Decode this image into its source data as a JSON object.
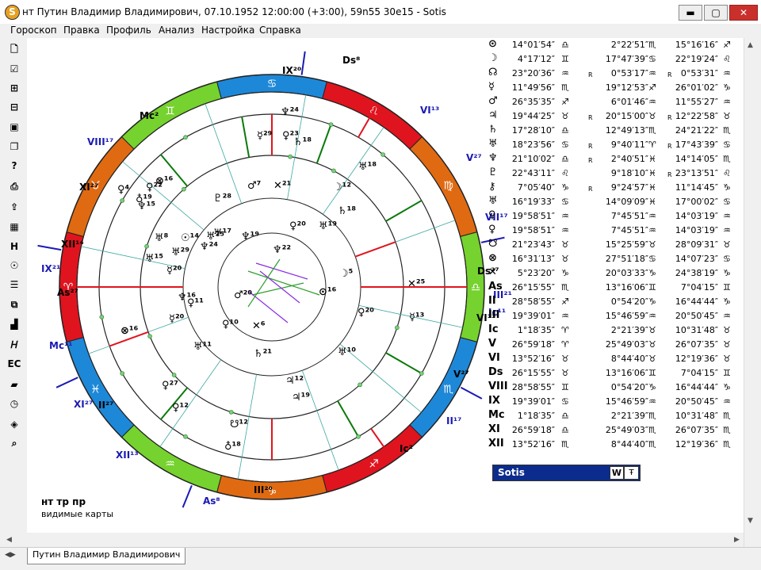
{
  "window": {
    "icon": "S",
    "title": "нт Путин Владимир Владимирович, 07.10.1952 12:00:00 (+3:00), 59n55 30e15 - Sotis",
    "minimize": "▬",
    "maximize": "▢",
    "close": "✕"
  },
  "menu": [
    "Гороскоп",
    "Правка",
    "Профиль",
    "Анализ",
    "Настройка",
    "Справка"
  ],
  "toolbar": [
    {
      "name": "new-doc-icon",
      "glyph": "🗋"
    },
    {
      "name": "check-doc-icon",
      "glyph": "☑"
    },
    {
      "name": "add-doc-icon",
      "glyph": "⊞"
    },
    {
      "name": "remove-doc-icon",
      "glyph": "⊟"
    },
    {
      "name": "picture-icon",
      "glyph": "▣"
    },
    {
      "name": "copy-icon",
      "glyph": "❐"
    },
    {
      "name": "help-doc-icon",
      "glyph": "?"
    },
    {
      "name": "print-icon",
      "glyph": "⎙"
    },
    {
      "name": "export-icon",
      "glyph": "⇪"
    },
    {
      "name": "grid-icon",
      "glyph": "▦"
    },
    {
      "name": "letter-h-icon",
      "glyph": "H"
    },
    {
      "name": "people-icon",
      "glyph": "☉"
    },
    {
      "name": "list-icon",
      "glyph": "☰"
    },
    {
      "name": "windows-icon",
      "glyph": "⧉"
    },
    {
      "name": "bar-chart-icon",
      "glyph": "▟"
    },
    {
      "name": "italic-h-icon",
      "glyph": "𝐻"
    },
    {
      "name": "ec-icon",
      "glyph": "EC"
    },
    {
      "name": "folder-icon",
      "glyph": "▰"
    },
    {
      "name": "clock-icon",
      "glyph": "◷"
    },
    {
      "name": "diamond-icon",
      "glyph": "◈"
    },
    {
      "name": "zoom-icon",
      "glyph": "⌕"
    }
  ],
  "colors": {
    "fire": "#e0141e",
    "earth": "#e06a12",
    "air": "#76d22e",
    "water": "#1e88d8",
    "axis_red": "#e0141e",
    "axis_blue": "#1a1ab4",
    "house_line": "#0a7a0a",
    "aspect_green": "#2e9e2e",
    "sotis_bar": "#0b2c8c"
  },
  "chart": {
    "signs": [
      "♈",
      "♉",
      "♊",
      "♋",
      "♌",
      "♍",
      "♎",
      "♏",
      "♐",
      "♑",
      "♒",
      "♓"
    ],
    "outer_labels": [
      {
        "t": "Ds⁸",
        "col": "#000"
      },
      {
        "t": "VI¹³",
        "col": "#1a1ab4"
      },
      {
        "t": "V²⁷",
        "col": "#1a1ab4"
      },
      {
        "t": "VII¹⁷",
        "col": "#1a1ab4"
      },
      {
        "t": "IX²⁰",
        "col": "#000"
      },
      {
        "t": "Mc²",
        "col": "#000"
      },
      {
        "t": "VIII¹⁷",
        "col": "#1a1ab4"
      },
      {
        "t": "XI²⁷",
        "col": "#000"
      },
      {
        "t": "XII¹⁴",
        "col": "#000"
      },
      {
        "t": "IX²¹",
        "col": "#1a1ab4"
      },
      {
        "t": "As²⁷",
        "col": "#000"
      },
      {
        "t": "Mc¹¹",
        "col": "#1a1ab4"
      },
      {
        "t": "XI²⁷",
        "col": "#1a1ab4"
      },
      {
        "t": "II²⁷",
        "col": "#000"
      },
      {
        "t": "XII¹³",
        "col": "#1a1ab4"
      },
      {
        "t": "As⁸",
        "col": "#1a1ab4"
      },
      {
        "t": "III²⁰",
        "col": "#000"
      },
      {
        "t": "Ic²",
        "col": "#000"
      },
      {
        "t": "II¹⁷",
        "col": "#1a1ab4"
      },
      {
        "t": "V²⁷",
        "col": "#000"
      },
      {
        "t": "VI¹³",
        "col": "#000"
      },
      {
        "t": "III²¹",
        "col": "#1a1ab4"
      },
      {
        "t": "Ds²⁷",
        "col": "#000"
      },
      {
        "t": "Ic¹¹",
        "col": "#1a1ab4"
      }
    ],
    "planet_labels": [
      "♆²⁴",
      "☿²⁹",
      "♀²³",
      "♄¹⁸",
      "♂⁷",
      "✕²¹",
      "☽¹²",
      "♇²⁸",
      "♅¹⁸",
      "♀²²",
      "♀⁴",
      "♁¹⁹",
      "♆¹⁵",
      "⊗¹⁶",
      "♅²⁵",
      "♅¹⁵",
      "♆²⁴",
      "☿²⁰",
      "♅²⁹",
      "♅⁸",
      "☉¹⁴",
      "♅¹⁷",
      "♆¹⁹",
      "♀¹¹",
      "⊗¹⁶",
      "☿²⁰",
      "♅¹¹",
      "✕²⁵",
      "☿¹³",
      "♀²⁰",
      "☽⁵",
      "⊙¹⁶",
      "♀²⁰",
      "♅¹⁹",
      "✕⁶",
      "♄¹⁸",
      "♀¹⁰",
      "♂²⁰",
      "♆¹⁶",
      "♄²¹",
      "♅¹⁰",
      "♃¹²",
      "♀²⁷",
      "♀¹²",
      "☋¹²",
      "♁¹⁸",
      "♃¹⁹",
      "♆²²"
    ],
    "legend_line1": "нт тр пр",
    "legend_line2": "видимые карты"
  },
  "table": [
    {
      "g": "⊙",
      "v1": "14°01′54″",
      "s1": "♎",
      "r2": "",
      "v2": "2°22′51″",
      "s2": "♏",
      "r3": "",
      "v3": "15°16′16″",
      "s3": "♐"
    },
    {
      "g": "☽",
      "v1": "4°17′12″",
      "s1": "♊",
      "r2": "",
      "v2": "17°47′39″",
      "s2": "♋",
      "r3": "",
      "v3": "22°19′24″",
      "s3": "♌"
    },
    {
      "g": "☊",
      "v1": "23°20′36″",
      "s1": "♒",
      "r2": "R",
      "v2": "0°53′17″",
      "s2": "♒",
      "r3": "R",
      "v3": "0°53′31″",
      "s3": "♒"
    },
    {
      "g": "☿",
      "v1": "11°49′56″",
      "s1": "♏",
      "r2": "",
      "v2": "19°12′53″",
      "s2": "♐",
      "r3": "",
      "v3": "26°01′02″",
      "s3": "♑"
    },
    {
      "g": "♂",
      "v1": "26°35′35″",
      "s1": "♐",
      "r2": "",
      "v2": "6°01′46″",
      "s2": "♒",
      "r3": "",
      "v3": "11°55′27″",
      "s3": "♒"
    },
    {
      "g": "♃",
      "v1": "19°44′25″",
      "s1": "♉",
      "r2": "R",
      "v2": "20°15′00″",
      "s2": "♉",
      "r3": "R",
      "v3": "12°22′58″",
      "s3": "♉"
    },
    {
      "g": "♄",
      "v1": "17°28′10″",
      "s1": "♎",
      "r2": "",
      "v2": "12°49′13″",
      "s2": "♏",
      "r3": "",
      "v3": "24°21′22″",
      "s3": "♏"
    },
    {
      "g": "♅",
      "v1": "18°23′56″",
      "s1": "♋",
      "r2": "R",
      "v2": "9°40′11″",
      "s2": "♈",
      "r3": "R",
      "v3": "17°43′39″",
      "s3": "♋"
    },
    {
      "g": "♆",
      "v1": "21°10′02″",
      "s1": "♎",
      "r2": "R",
      "v2": "2°40′51″",
      "s2": "♓",
      "r3": "",
      "v3": "14°14′05″",
      "s3": "♏"
    },
    {
      "g": "♇",
      "v1": "22°43′11″",
      "s1": "♌",
      "r2": "",
      "v2": "9°18′10″",
      "s2": "♓",
      "r3": "R",
      "v3": "23°13′51″",
      "s3": "♌"
    },
    {
      "g": "⚷",
      "v1": "7°05′40″",
      "s1": "♑",
      "r2": "R",
      "v2": "9°24′57″",
      "s2": "♓",
      "r3": "",
      "v3": "11°14′45″",
      "s3": "♑"
    },
    {
      "g": "♅",
      "v1": "16°19′33″",
      "s1": "♋",
      "r2": "",
      "v2": "14°09′09″",
      "s2": "♓",
      "r3": "",
      "v3": "17°00′02″",
      "s3": "♋"
    },
    {
      "g": "♀",
      "v1": "19°58′51″",
      "s1": "♒",
      "r2": "",
      "v2": "7°45′51″",
      "s2": "♒",
      "r3": "",
      "v3": "14°03′19″",
      "s3": "♒"
    },
    {
      "g": "♀",
      "v1": "19°58′51″",
      "s1": "♒",
      "r2": "",
      "v2": "7°45′51″",
      "s2": "♒",
      "r3": "",
      "v3": "14°03′19″",
      "s3": "♒"
    },
    {
      "g": "☋",
      "v1": "21°23′43″",
      "s1": "♉",
      "r2": "",
      "v2": "15°25′59″",
      "s2": "♉",
      "r3": "",
      "v3": "28°09′31″",
      "s3": "♉"
    },
    {
      "g": "⊗",
      "v1": "16°31′13″",
      "s1": "♉",
      "r2": "",
      "v2": "27°51′18″",
      "s2": "♋",
      "r3": "",
      "v3": "14°07′23″",
      "s3": "♋"
    },
    {
      "g": "✕",
      "v1": "5°23′20″",
      "s1": "♑",
      "r2": "",
      "v2": "20°03′33″",
      "s2": "♑",
      "r3": "",
      "v3": "24°38′19″",
      "s3": "♑"
    },
    {
      "g": "As",
      "v1": "26°15′55″",
      "s1": "♏",
      "r2": "",
      "v2": "13°16′06″",
      "s2": "♊",
      "r3": "",
      "v3": "7°04′15″",
      "s3": "♊"
    },
    {
      "g": "II",
      "v1": "28°58′55″",
      "s1": "♐",
      "r2": "",
      "v2": "0°54′20″",
      "s2": "♑",
      "r3": "",
      "v3": "16°44′44″",
      "s3": "♑"
    },
    {
      "g": "III",
      "v1": "19°39′01″",
      "s1": "♒",
      "r2": "",
      "v2": "15°46′59″",
      "s2": "♒",
      "r3": "",
      "v3": "20°50′45″",
      "s3": "♒"
    },
    {
      "g": "Ic",
      "v1": "1°18′35″",
      "s1": "♈",
      "r2": "",
      "v2": "2°21′39″",
      "s2": "♉",
      "r3": "",
      "v3": "10°31′48″",
      "s3": "♉"
    },
    {
      "g": "V",
      "v1": "26°59′18″",
      "s1": "♈",
      "r2": "",
      "v2": "25°49′03″",
      "s2": "♉",
      "r3": "",
      "v3": "26°07′35″",
      "s3": "♉"
    },
    {
      "g": "VI",
      "v1": "13°52′16″",
      "s1": "♉",
      "r2": "",
      "v2": "8°44′40″",
      "s2": "♉",
      "r3": "",
      "v3": "12°19′36″",
      "s3": "♉"
    },
    {
      "g": "Ds",
      "v1": "26°15′55″",
      "s1": "♉",
      "r2": "",
      "v2": "13°16′06″",
      "s2": "♊",
      "r3": "",
      "v3": "7°04′15″",
      "s3": "♊"
    },
    {
      "g": "VIII",
      "v1": "28°58′55″",
      "s1": "♊",
      "r2": "",
      "v2": "0°54′20″",
      "s2": "♑",
      "r3": "",
      "v3": "16°44′44″",
      "s3": "♑"
    },
    {
      "g": "IX",
      "v1": "19°39′01″",
      "s1": "♋",
      "r2": "",
      "v2": "15°46′59″",
      "s2": "♒",
      "r3": "",
      "v3": "20°50′45″",
      "s3": "♒"
    },
    {
      "g": "Mc",
      "v1": "1°18′35″",
      "s1": "♎",
      "r2": "",
      "v2": "2°21′39″",
      "s2": "♏",
      "r3": "",
      "v3": "10°31′48″",
      "s3": "♏"
    },
    {
      "g": "XI",
      "v1": "26°59′18″",
      "s1": "♎",
      "r2": "",
      "v2": "25°49′03″",
      "s2": "♏",
      "r3": "",
      "v3": "26°07′35″",
      "s3": "♏"
    },
    {
      "g": "XII",
      "v1": "13°52′16″",
      "s1": "♏",
      "r2": "",
      "v2": "8°44′40″",
      "s2": "♏",
      "r3": "",
      "v3": "12°19′36″",
      "s3": "♏"
    }
  ],
  "sotis_box": {
    "label": "Sotis",
    "w_button": "W",
    "t_button": "Ŧ"
  },
  "tab": {
    "label": "Путин Владимир Владимирович"
  }
}
